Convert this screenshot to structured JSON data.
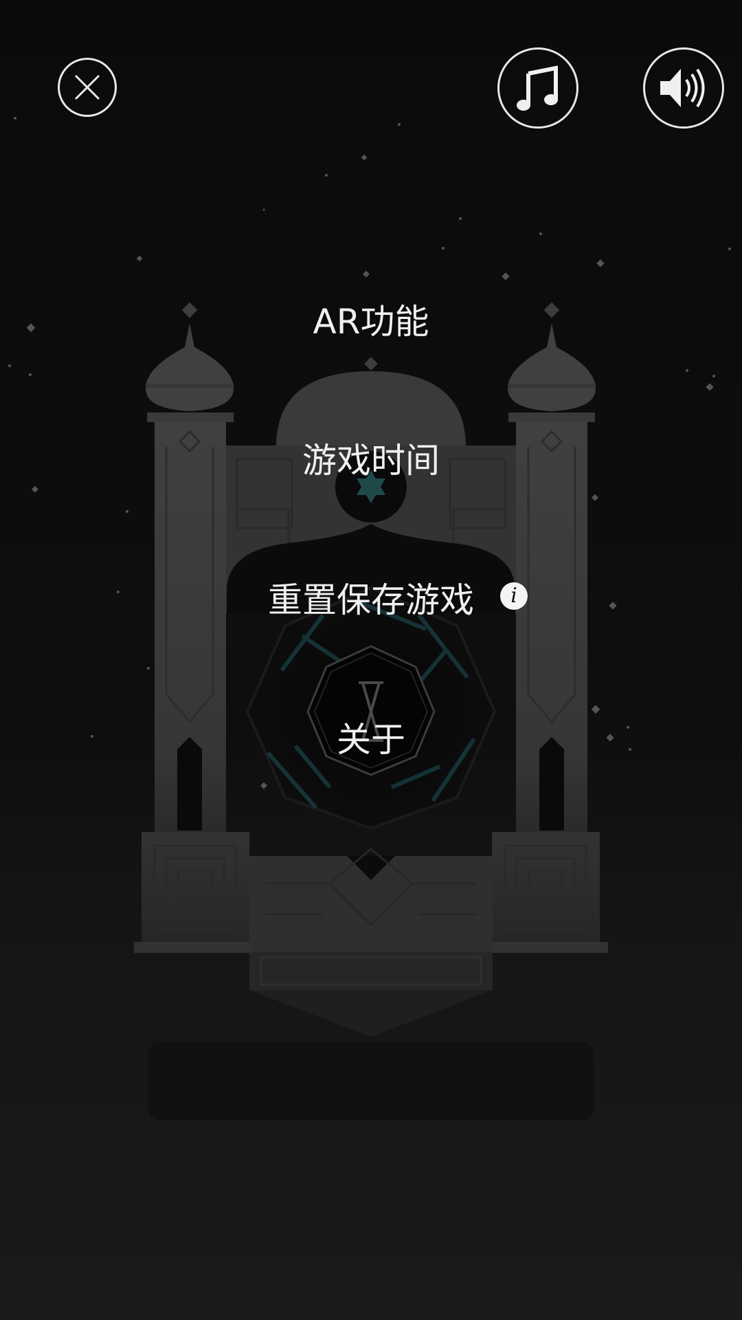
{
  "menu": {
    "ar": "AR功能",
    "playtime": "游戏时间",
    "reset": "重置保存游戏",
    "about": "关于"
  },
  "info_glyph": "i",
  "icons": {
    "close": "close-icon",
    "music": "music-note-icon",
    "sound": "speaker-icon",
    "info": "info-icon"
  },
  "colors": {
    "background": "#0b0b0b",
    "tower": "#3a3a3a",
    "accent_teal": "#2a5a5a",
    "text": "#f0f0f0"
  }
}
